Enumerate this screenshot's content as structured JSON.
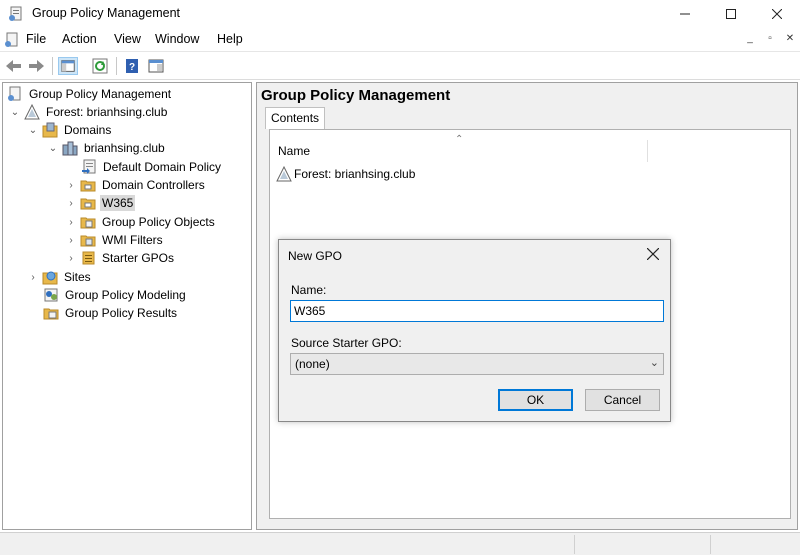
{
  "window": {
    "title": "Group Policy Management",
    "icon": "gpmc-app-icon",
    "controls": [
      "minimize-icon",
      "maximize-icon",
      "close-icon"
    ]
  },
  "menu": {
    "items": [
      "File",
      "Action",
      "View",
      "Window",
      "Help"
    ],
    "mdi_controls": [
      "_",
      "▫",
      "✕"
    ]
  },
  "toolbar": {
    "buttons": [
      "back-icon",
      "forward-icon",
      "show-hide-tree-icon",
      "refresh-icon",
      "help-icon",
      "properties-icon"
    ]
  },
  "tree": {
    "nodes": [
      {
        "label": "Group Policy Management",
        "icon": "gpmc-icon",
        "expander": ""
      },
      {
        "label": "Forest: brianhsing.club",
        "icon": "forest-icon",
        "expander": "expanded"
      },
      {
        "label": "Domains",
        "icon": "domains-icon",
        "expander": "expanded"
      },
      {
        "label": "brianhsing.club",
        "icon": "domain-icon",
        "expander": "expanded"
      },
      {
        "label": "Default Domain Policy",
        "icon": "gpo-link-icon",
        "expander": ""
      },
      {
        "label": "Domain Controllers",
        "icon": "ou-icon",
        "expander": "collapsed"
      },
      {
        "label": "W365",
        "icon": "ou-icon",
        "expander": "collapsed",
        "selected": true
      },
      {
        "label": "Group Policy Objects",
        "icon": "gpo-folder-icon",
        "expander": "collapsed"
      },
      {
        "label": "WMI Filters",
        "icon": "wmi-folder-icon",
        "expander": "collapsed"
      },
      {
        "label": "Starter GPOs",
        "icon": "starter-folder-icon",
        "expander": "collapsed"
      },
      {
        "label": "Sites",
        "icon": "sites-icon",
        "expander": "collapsed"
      },
      {
        "label": "Group Policy Modeling",
        "icon": "modeling-icon",
        "expander": ""
      },
      {
        "label": "Group Policy Results",
        "icon": "results-icon",
        "expander": ""
      }
    ]
  },
  "right_pane": {
    "title": "Group Policy Management",
    "tab": "Contents",
    "column_header": "Name",
    "rows": [
      {
        "label": "Forest: brianhsing.club",
        "icon": "forest-icon"
      }
    ]
  },
  "dialog": {
    "title": "New GPO",
    "name_label": "Name:",
    "name_value": "W365",
    "starter_label": "Source Starter GPO:",
    "starter_value": "(none)",
    "ok_label": "OK",
    "cancel_label": "Cancel"
  },
  "colors": {
    "accent": "#0078d7",
    "selection": "#d9d9d9",
    "folder": "#e8b84a"
  }
}
